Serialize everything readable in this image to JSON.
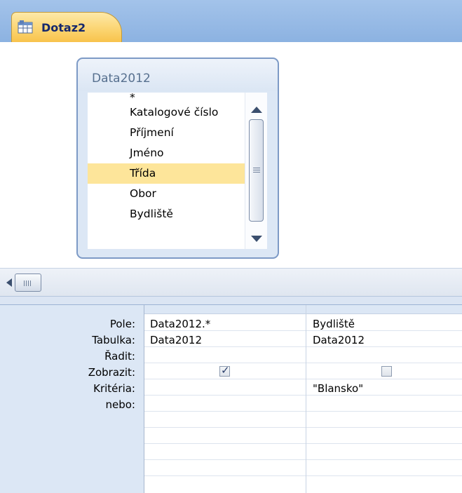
{
  "tab": {
    "label": "Dotaz2",
    "icon": "query-icon"
  },
  "table_box": {
    "title": "Data2012",
    "fields": [
      "*",
      "Katalogové číslo",
      "Příjmení",
      "Jméno",
      "Třída",
      "Obor",
      "Bydliště"
    ],
    "selected_field": "Třída"
  },
  "grid": {
    "row_labels": {
      "field": "Pole:",
      "table": "Tabulka:",
      "sort": "Řadit:",
      "show": "Zobrazit:",
      "criteria": "Kritéria:",
      "or": "nebo:"
    },
    "columns": [
      {
        "field": "Data2012.*",
        "table": "Data2012",
        "sort": "",
        "show": true,
        "criteria": "",
        "or": ""
      },
      {
        "field": "Bydliště",
        "table": "Data2012",
        "sort": "",
        "show": false,
        "criteria": "\"Blansko\"",
        "or": ""
      }
    ]
  }
}
